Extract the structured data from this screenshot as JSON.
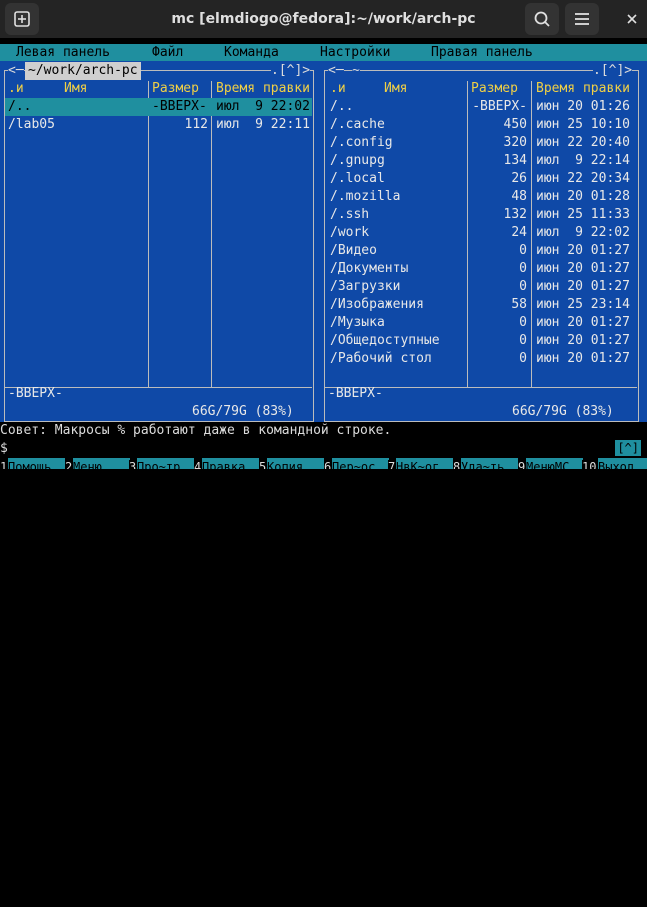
{
  "window": {
    "title": "mc [elmdiogo@fedora]:~/work/arch-pc"
  },
  "menu": [
    "Левая панель",
    "Файл",
    "Команда",
    "Настройки",
    "Правая панель"
  ],
  "left_panel": {
    "path": "~/work/arch-pc",
    "corner": ".[^]>",
    "headers": {
      "n": ".и",
      "name": "Имя",
      "size": "Размер",
      "time": "Время правки"
    },
    "rows": [
      {
        "name": "/..",
        "size": "-ВВЕРХ-",
        "time": "июл  9 22:02",
        "selected": true
      },
      {
        "name": "/lab05",
        "size": "112",
        "time": "июл  9 22:11",
        "selected": false
      }
    ],
    "status": "-ВВЕРХ-",
    "disk": "66G/79G (83%)"
  },
  "right_panel": {
    "path": "~",
    "corner": ".[^]>",
    "headers": {
      "n": ".и",
      "name": "Имя",
      "size": "Размер",
      "time": "Время правки"
    },
    "rows": [
      {
        "name": "/..",
        "size": "-ВВЕРХ-",
        "time": "июн 20 01:26"
      },
      {
        "name": "/.cache",
        "size": "450",
        "time": "июн 25 10:10"
      },
      {
        "name": "/.config",
        "size": "320",
        "time": "июн 22 20:40"
      },
      {
        "name": "/.gnupg",
        "size": "134",
        "time": "июл  9 22:14"
      },
      {
        "name": "/.local",
        "size": "26",
        "time": "июн 22 20:34"
      },
      {
        "name": "/.mozilla",
        "size": "48",
        "time": "июн 20 01:28"
      },
      {
        "name": "/.ssh",
        "size": "132",
        "time": "июн 25 11:33"
      },
      {
        "name": "/work",
        "size": "24",
        "time": "июл  9 22:02"
      },
      {
        "name": "/Видео",
        "size": "0",
        "time": "июн 20 01:27"
      },
      {
        "name": "/Документы",
        "size": "0",
        "time": "июн 20 01:27"
      },
      {
        "name": "/Загрузки",
        "size": "0",
        "time": "июн 20 01:27"
      },
      {
        "name": "/Изображения",
        "size": "58",
        "time": "июн 25 23:14"
      },
      {
        "name": "/Музыка",
        "size": "0",
        "time": "июн 20 01:27"
      },
      {
        "name": "/Общедоступные",
        "size": "0",
        "time": "июн 20 01:27"
      },
      {
        "name": "/Рабочий стол",
        "size": "0",
        "time": "июн 20 01:27"
      }
    ],
    "status": "-ВВЕРХ-",
    "disk": "66G/79G (83%)"
  },
  "hint": "Совет: Макросы % работают даже в командной строке.",
  "prompt": "$",
  "cmd_icon": "[^]",
  "fkeys": [
    {
      "num": "1",
      "label": "Помощь"
    },
    {
      "num": "2",
      "label": "Меню"
    },
    {
      "num": "3",
      "label": "Про~тр"
    },
    {
      "num": "4",
      "label": "Правка"
    },
    {
      "num": "5",
      "label": "Копия"
    },
    {
      "num": "6",
      "label": "Пер~ос"
    },
    {
      "num": "7",
      "label": "НвК~ог"
    },
    {
      "num": "8",
      "label": "Уда~ть"
    },
    {
      "num": "9",
      "label": "МенюМС"
    },
    {
      "num": "10",
      "label": "Выход"
    }
  ],
  "colors": {
    "panel_bg": "#0f49a7",
    "accent": "#1f8f9f",
    "header": "#f0d046"
  },
  "icons": [
    "new-tab-icon",
    "search-icon",
    "hamburger-menu-icon",
    "close-icon"
  ]
}
